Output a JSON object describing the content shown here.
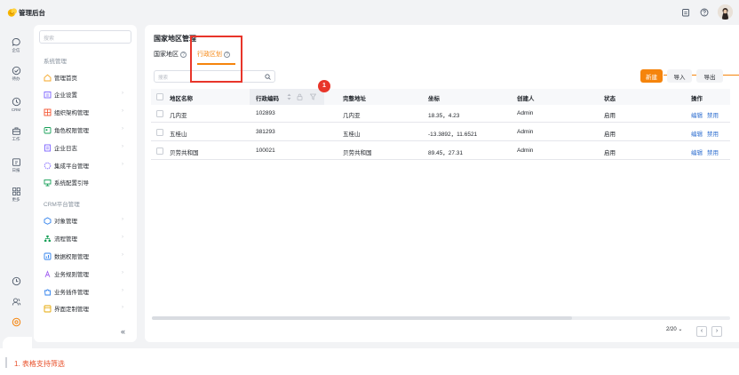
{
  "app": {
    "title": "管理后台",
    "accent": "#f5840c",
    "highlight_color": "#e8352a"
  },
  "topbar": {
    "icons": [
      "clipboard-icon",
      "help-icon",
      "avatar"
    ]
  },
  "rail": {
    "items": [
      {
        "label": "企信",
        "icon": "chat-icon"
      },
      {
        "label": "待办",
        "icon": "check-icon"
      },
      {
        "label": "CRM",
        "icon": "clock-icon"
      },
      {
        "label": "工作",
        "icon": "briefcase-icon"
      },
      {
        "label": "日报",
        "icon": "report-icon"
      },
      {
        "label": "更多",
        "icon": "grid-icon"
      }
    ],
    "bottom_icons": [
      "history-icon",
      "users-icon",
      "settings-icon"
    ]
  },
  "menu": {
    "search_placeholder": "搜索",
    "group1": "系统管理",
    "items1": [
      {
        "label": "管理首页",
        "icon": "home-icon",
        "chevron": false
      },
      {
        "label": "企业设置",
        "icon": "enterprise-icon",
        "chevron": true
      },
      {
        "label": "组织架构管理",
        "icon": "org-icon",
        "chevron": true
      },
      {
        "label": "角色权限管理",
        "icon": "role-icon",
        "chevron": true
      },
      {
        "label": "企业日志",
        "icon": "log-icon",
        "chevron": true
      },
      {
        "label": "集成平台管理",
        "icon": "integration-icon",
        "chevron": true
      },
      {
        "label": "系统配置引导",
        "icon": "guide-icon",
        "chevron": false
      }
    ],
    "group2": "CRM平台管理",
    "items2": [
      {
        "label": "对象管理",
        "icon": "object-icon",
        "chevron": true
      },
      {
        "label": "流程管理",
        "icon": "flow-icon",
        "chevron": true
      },
      {
        "label": "数据权限管理",
        "icon": "data-permission-icon",
        "chevron": true
      },
      {
        "label": "业务规则管理",
        "icon": "rule-icon",
        "chevron": true
      },
      {
        "label": "业务插件管理",
        "icon": "plugin-icon",
        "chevron": true
      },
      {
        "label": "界面定制管理",
        "icon": "ui-custom-icon",
        "chevron": true
      }
    ],
    "collapse_label": "«"
  },
  "main": {
    "title": "国家地区管理",
    "tabs": [
      {
        "label": "国家地区",
        "active": false
      },
      {
        "label": "行政区划",
        "active": true
      }
    ],
    "search_placeholder": "搜索",
    "buttons": {
      "new": "新建",
      "import": "导入",
      "export": "导出"
    },
    "marker": "1",
    "table": {
      "columns": [
        "地区名称",
        "行政编码",
        "完整地址",
        "坐标",
        "创建人",
        "状态",
        "操作"
      ],
      "rows": [
        {
          "name": "几内亚",
          "code": "102893",
          "address": "几内亚",
          "coords": "18.35，4.23",
          "creator": "Admin",
          "status": "启用",
          "edit": "编辑",
          "disable": "禁用"
        },
        {
          "name": "五桂山",
          "code": "381293",
          "address": "五桂山",
          "coords": "-13.3892，11.6521",
          "creator": "Admin",
          "status": "启用",
          "edit": "编辑",
          "disable": "禁用"
        },
        {
          "name": "贝劳共和国",
          "code": "100021",
          "address": "贝劳共和国",
          "coords": "89.45，27.31",
          "creator": "Admin",
          "status": "启用",
          "edit": "编辑",
          "disable": "禁用"
        }
      ]
    },
    "pagination": {
      "page_size": "2/20",
      "prev": "‹",
      "next": "›"
    }
  },
  "note": "1. 表格支持筛选"
}
